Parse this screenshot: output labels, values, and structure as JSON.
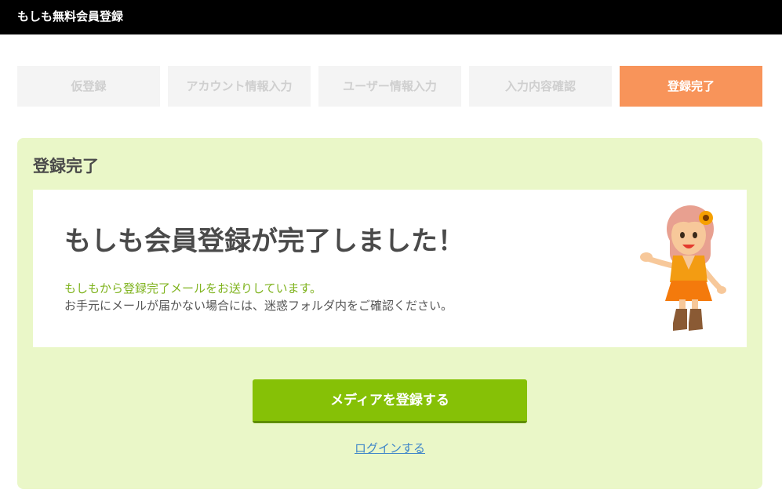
{
  "header": {
    "title": "もしも無料会員登録"
  },
  "steps": [
    {
      "label": "仮登録",
      "active": false
    },
    {
      "label": "アカウント情報入力",
      "active": false
    },
    {
      "label": "ユーザー情報入力",
      "active": false
    },
    {
      "label": "入力内容確認",
      "active": false
    },
    {
      "label": "登録完了",
      "active": true
    }
  ],
  "panel": {
    "title": "登録完了",
    "headline": "もしも会員登録が完了しました！",
    "note_green": "もしもから登録完了メールをお送りしています。",
    "note_gray": "お手元にメールが届かない場合には、迷惑フォルダ内をご確認ください。",
    "mascot_icon": "mascot-girl-icon"
  },
  "actions": {
    "primary_label": "メディアを登録する",
    "login_label": "ログインする"
  },
  "colors": {
    "header_bg": "#000000",
    "step_inactive_bg": "#f4f4f4",
    "step_active_bg": "#f8945a",
    "panel_bg": "#eaf7c8",
    "primary_btn": "#86c106",
    "note_green": "#7fb31e",
    "link": "#3f86c9"
  }
}
